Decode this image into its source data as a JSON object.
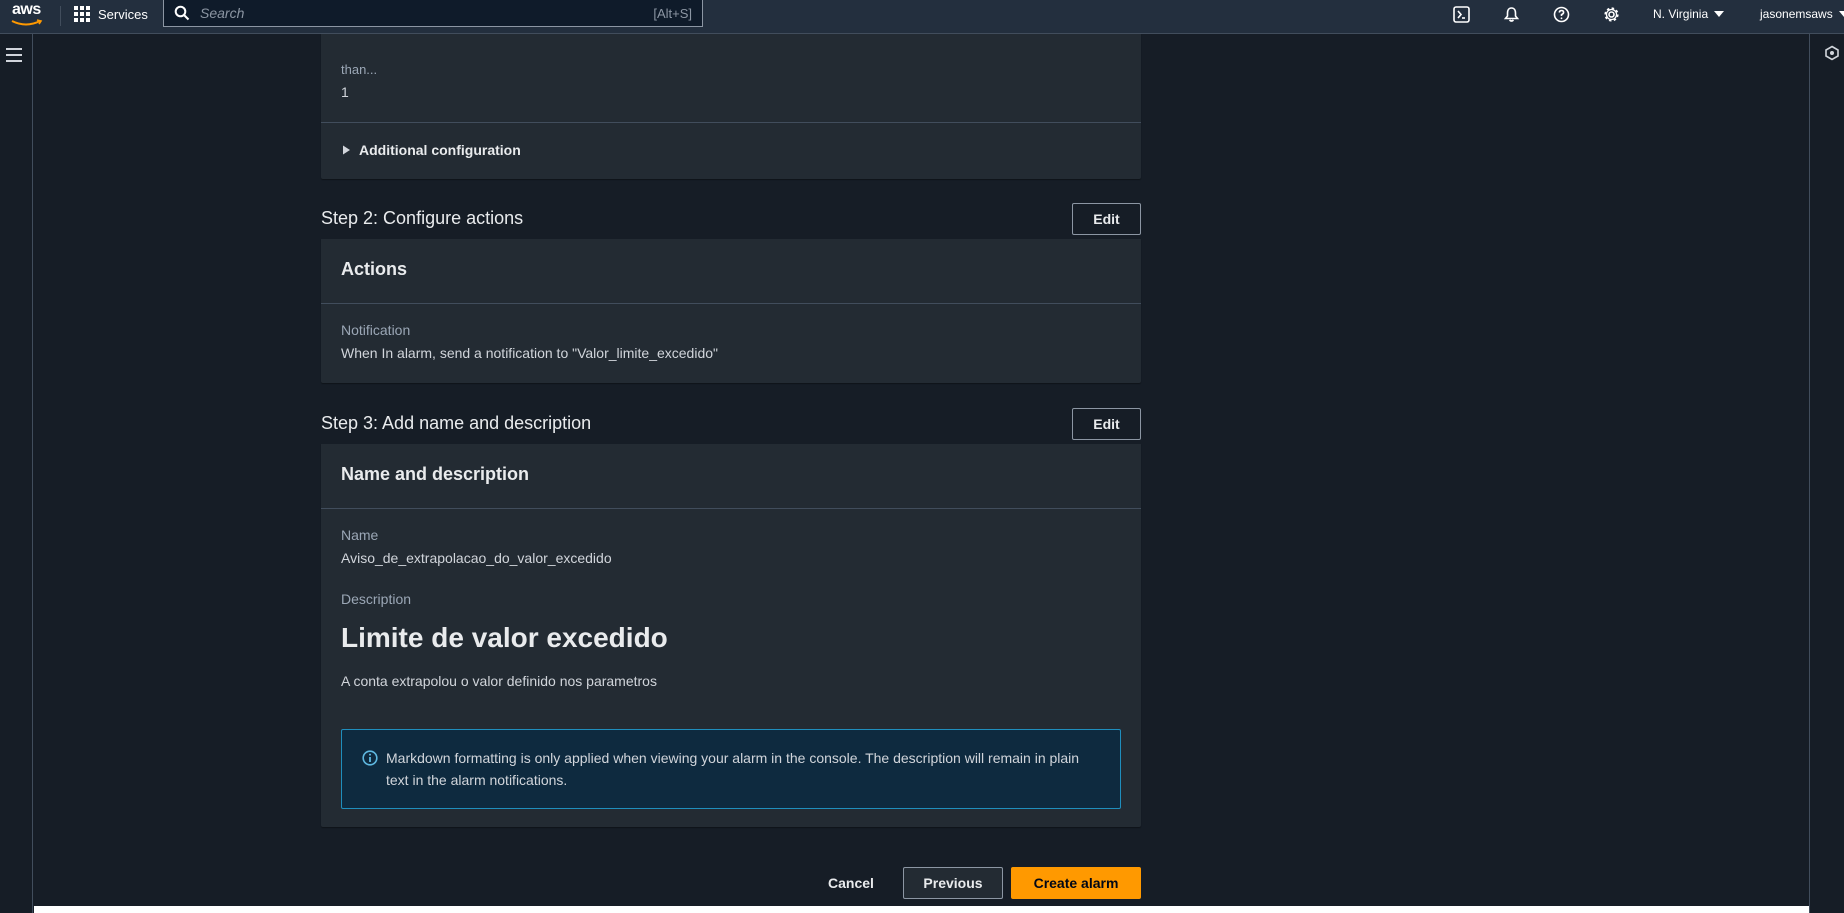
{
  "topnav": {
    "logo_text": "aws",
    "services_label": "Services",
    "search_placeholder": "Search",
    "search_shortcut": "[Alt+S]",
    "region": "N. Virginia",
    "user": "jasonemsaws",
    "icons": [
      "cloudshell-icon",
      "notifications-icon",
      "help-icon",
      "settings-icon"
    ]
  },
  "step1_tail": {
    "label": "than...",
    "value": "1",
    "additional_config": "Additional configuration"
  },
  "step2": {
    "title": "Step 2: Configure actions",
    "edit_label": "Edit",
    "header": "Actions",
    "notification_label": "Notification",
    "notification_value": "When In alarm, send a notification to \"Valor_limite_excedido\""
  },
  "step3": {
    "title": "Step 3: Add name and description",
    "edit_label": "Edit",
    "header": "Name and description",
    "name_label": "Name",
    "name_value": "Aviso_de_extrapolacao_do_valor_excedido",
    "description_label": "Description",
    "description_heading": "Limite de valor excedido",
    "description_text": "A conta extrapolou o valor definido nos parametros",
    "info_text": "Markdown formatting is only applied when viewing your alarm in the console. The description will remain in plain text in the alarm notifications."
  },
  "footer": {
    "cancel": "Cancel",
    "previous": "Previous",
    "create": "Create alarm"
  },
  "colors": {
    "topnav_bg": "#232f3e",
    "page_bg": "#161d26",
    "container_bg": "#232b33",
    "primary_button": "#ff9900",
    "info_border": "#1f8ebd"
  }
}
